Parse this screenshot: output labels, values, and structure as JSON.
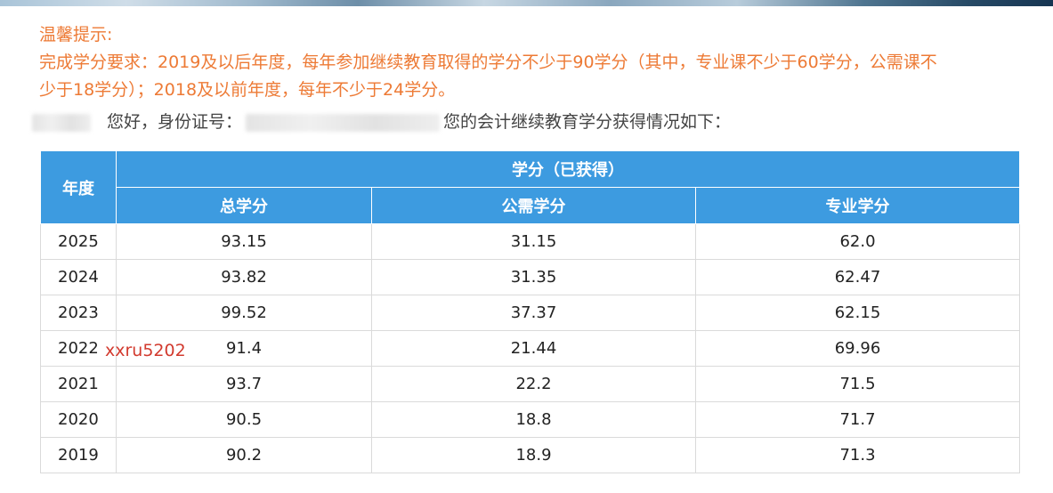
{
  "notice": {
    "title": "温馨提示:",
    "line1": "完成学分要求：2019及以后年度，每年参加继续教育取得的学分不少于90学分（其中，专业课不少于60学分，公需课不",
    "line2": "少于18学分）；2018及以前年度，每年不少于24学分。"
  },
  "greeting": {
    "hello": "您好，身份证号：",
    "suffix": "您的会计继续教育学分获得情况如下："
  },
  "table": {
    "year_header": "年度",
    "group_header": "学分（已获得）",
    "columns": [
      "总学分",
      "公需学分",
      "专业学分"
    ],
    "rows": [
      {
        "year": "2025",
        "total": "93.15",
        "public": "31.15",
        "major": "62.0"
      },
      {
        "year": "2024",
        "total": "93.82",
        "public": "31.35",
        "major": "62.47"
      },
      {
        "year": "2023",
        "total": "99.52",
        "public": "37.37",
        "major": "62.15"
      },
      {
        "year": "2022",
        "total": "91.4",
        "public": "21.44",
        "major": "69.96"
      },
      {
        "year": "2021",
        "total": "93.7",
        "public": "22.2",
        "major": "71.5"
      },
      {
        "year": "2020",
        "total": "90.5",
        "public": "18.8",
        "major": "71.7"
      },
      {
        "year": "2019",
        "total": "90.2",
        "public": "18.9",
        "major": "71.3"
      }
    ]
  },
  "watermark": "xxru5202",
  "colors": {
    "notice": "#ed7a35",
    "header_bg": "#3d9be0",
    "watermark": "#d23a2e"
  }
}
